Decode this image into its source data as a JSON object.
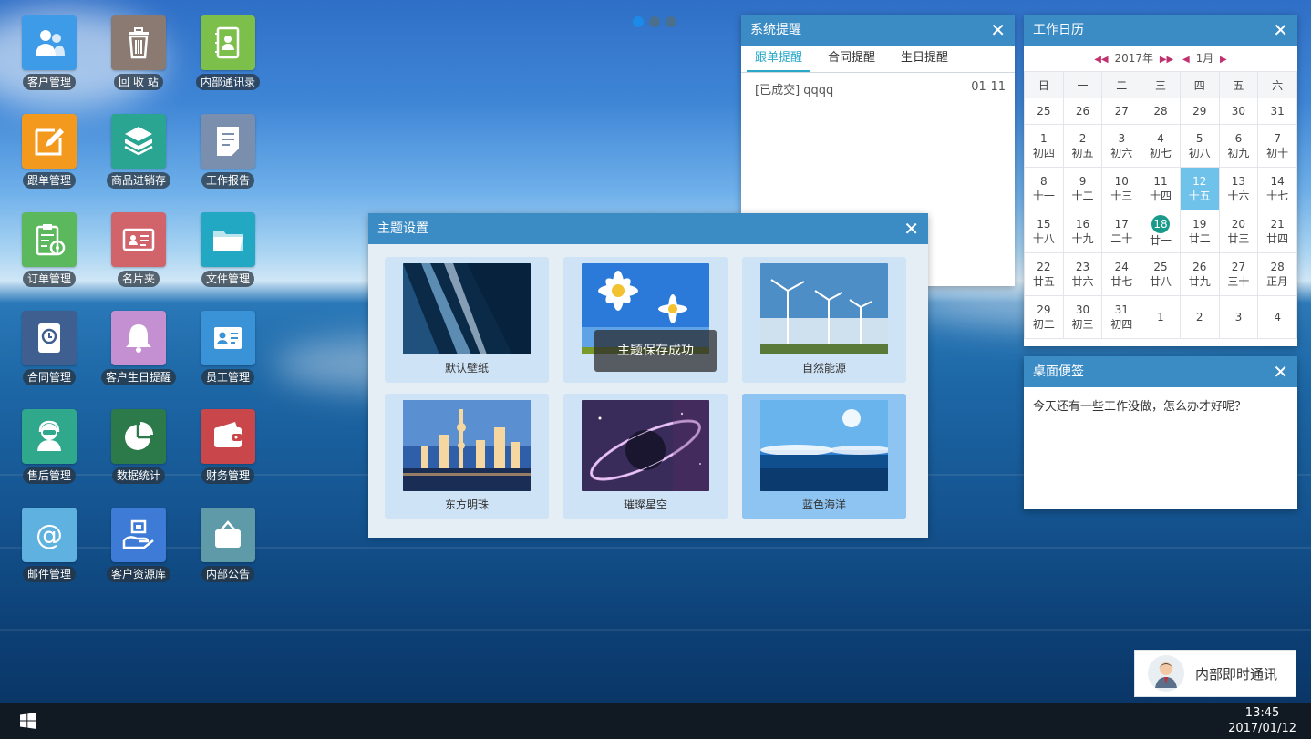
{
  "desktop": {
    "icons": [
      {
        "label": "客户管理",
        "icon": "customer-icon",
        "color": "#3d9be8"
      },
      {
        "label": "回 收 站",
        "icon": "trash-icon",
        "color": "#8a7a72"
      },
      {
        "label": "内部通讯录",
        "icon": "address-book-icon",
        "color": "#7cbf4a"
      },
      {
        "label": "跟单管理",
        "icon": "edit-icon",
        "color": "#f39a1e"
      },
      {
        "label": "商品进销存",
        "icon": "box-icon",
        "color": "#2aa591"
      },
      {
        "label": "工作报告",
        "icon": "report-icon",
        "color": "#7a8fae"
      },
      {
        "label": "订单管理",
        "icon": "clipboard-icon",
        "color": "#5cb85c"
      },
      {
        "label": "名片夹",
        "icon": "card-icon",
        "color": "#d0646a"
      },
      {
        "label": "文件管理",
        "icon": "folder-icon",
        "color": "#23a8c4"
      },
      {
        "label": "合同管理",
        "icon": "contract-icon",
        "color": "#3e5f8f"
      },
      {
        "label": "客户生日提醒",
        "icon": "bell-icon",
        "color": "#c490d1"
      },
      {
        "label": "员工管理",
        "icon": "employee-icon",
        "color": "#3a93d6"
      },
      {
        "label": "售后管理",
        "icon": "support-icon",
        "color": "#2fa88c"
      },
      {
        "label": "数据统计",
        "icon": "pie-chart-icon",
        "color": "#2c7a4a"
      },
      {
        "label": "财务管理",
        "icon": "wallet-icon",
        "color": "#c9464a"
      },
      {
        "label": "邮件管理",
        "icon": "at-icon",
        "color": "#5fb1e0"
      },
      {
        "label": "客户资源库",
        "icon": "resource-icon",
        "color": "#3d7bd6"
      },
      {
        "label": "内部公告",
        "icon": "notice-icon",
        "color": "#5f9aa8"
      }
    ]
  },
  "reminders": {
    "title": "系统提醒",
    "close": "✕",
    "tabs": [
      "跟单提醒",
      "合同提醒",
      "生日提醒"
    ],
    "active_tab": 0,
    "items": [
      {
        "text": "[已成交] qqqq",
        "date": "01-11"
      }
    ]
  },
  "calendar": {
    "title": "工作日历",
    "close": "✕",
    "year": "2017年",
    "month": "1月",
    "weekdays": [
      "日",
      "一",
      "二",
      "三",
      "四",
      "五",
      "六"
    ],
    "first_row": [
      "25",
      "26",
      "27",
      "28",
      "29",
      "30",
      "31"
    ],
    "weeks": [
      [
        [
          "1",
          "初四"
        ],
        [
          "2",
          "初五"
        ],
        [
          "3",
          "初六"
        ],
        [
          "4",
          "初七"
        ],
        [
          "5",
          "初八"
        ],
        [
          "6",
          "初九"
        ],
        [
          "7",
          "初十"
        ]
      ],
      [
        [
          "8",
          "十一"
        ],
        [
          "9",
          "十二"
        ],
        [
          "10",
          "十三"
        ],
        [
          "11",
          "十四"
        ],
        [
          "12",
          "十五"
        ],
        [
          "13",
          "十六"
        ],
        [
          "14",
          "十七"
        ]
      ],
      [
        [
          "15",
          "十八"
        ],
        [
          "16",
          "十九"
        ],
        [
          "17",
          "二十"
        ],
        [
          "18",
          "廿一"
        ],
        [
          "19",
          "廿二"
        ],
        [
          "20",
          "廿三"
        ],
        [
          "21",
          "廿四"
        ]
      ],
      [
        [
          "22",
          "廿五"
        ],
        [
          "23",
          "廿六"
        ],
        [
          "24",
          "廿七"
        ],
        [
          "25",
          "廿八"
        ],
        [
          "26",
          "廿九"
        ],
        [
          "27",
          "三十"
        ],
        [
          "28",
          "正月"
        ]
      ],
      [
        [
          "29",
          "初二"
        ],
        [
          "30",
          "初三"
        ],
        [
          "31",
          "初四"
        ],
        [
          "1",
          ""
        ],
        [
          "2",
          ""
        ],
        [
          "3",
          ""
        ],
        [
          "4",
          ""
        ]
      ]
    ],
    "selected": "12",
    "today": "18"
  },
  "note": {
    "title": "桌面便签",
    "close": "✕",
    "text": "今天还有一些工作没做，怎么办才好呢？"
  },
  "theme_dialog": {
    "title": "主题设置",
    "close": "✕",
    "themes": [
      {
        "name": "默认壁纸",
        "selected": false
      },
      {
        "name": "",
        "selected": false
      },
      {
        "name": "自然能源",
        "selected": false
      },
      {
        "name": "东方明珠",
        "selected": false
      },
      {
        "name": "璀璨星空",
        "selected": false
      },
      {
        "name": "蓝色海洋",
        "selected": true
      }
    ],
    "toast": "主题保存成功"
  },
  "chat": {
    "label": "内部即时通讯"
  },
  "taskbar": {
    "time": "13:45",
    "date": "2017/01/12"
  }
}
